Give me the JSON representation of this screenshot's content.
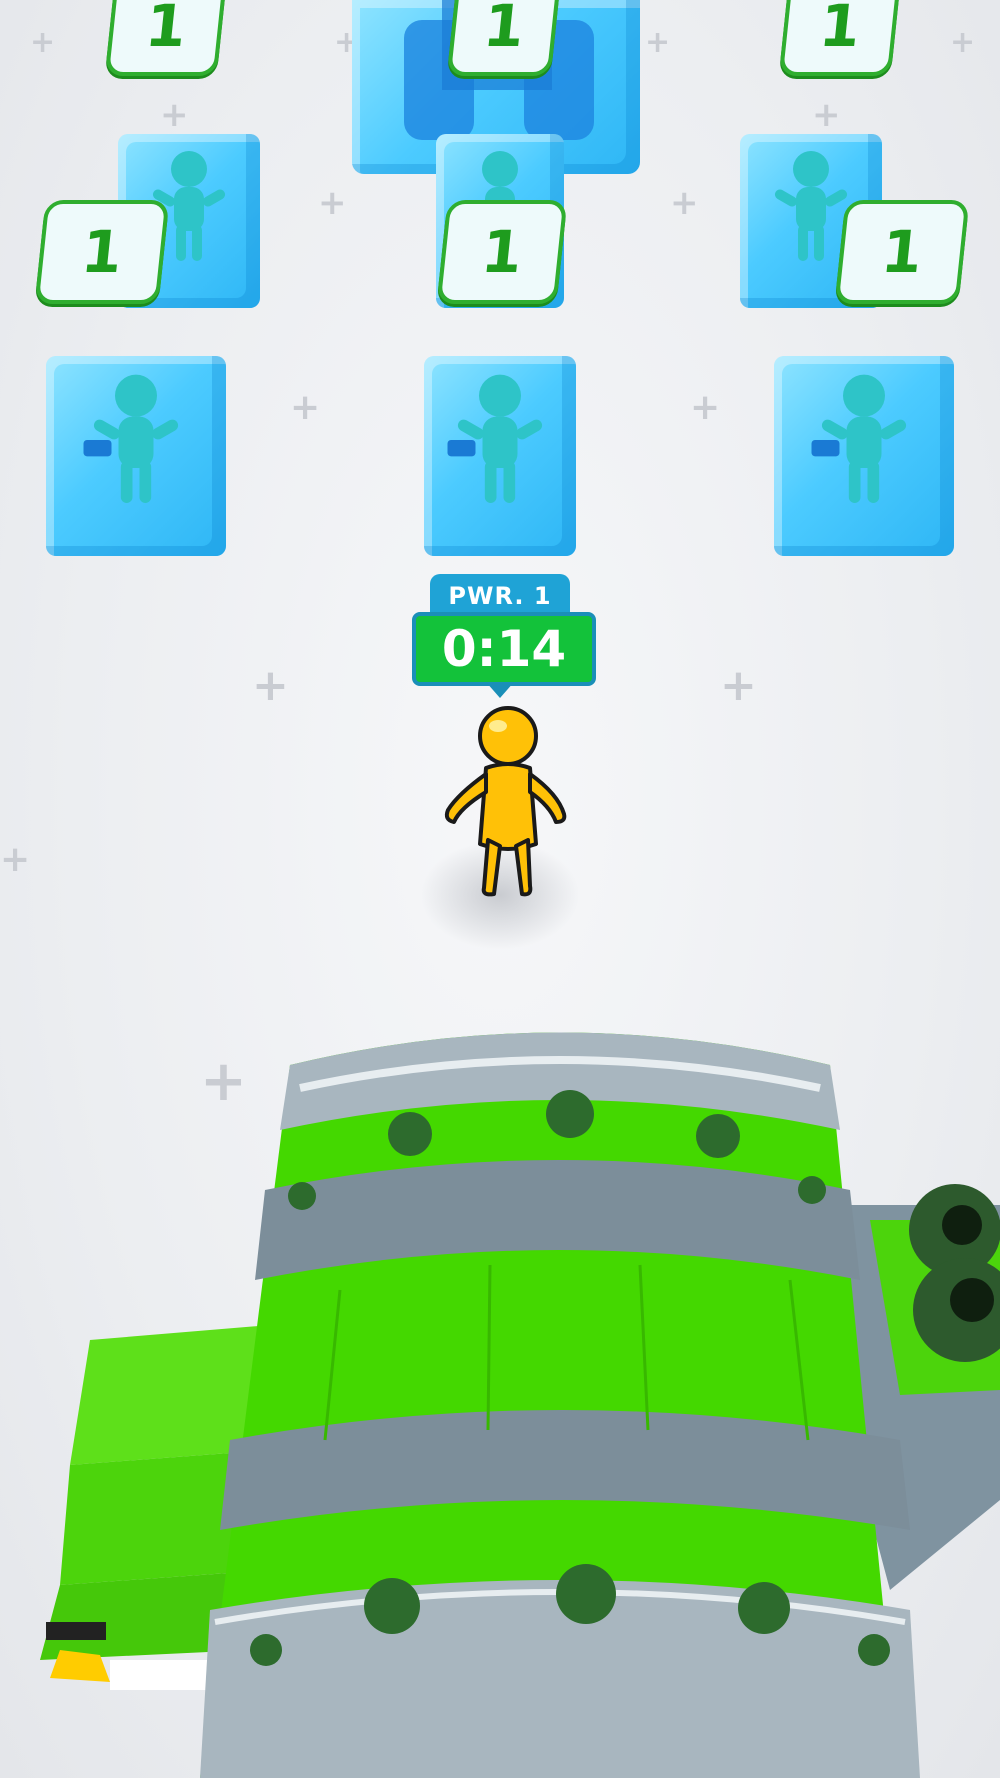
{
  "hud": {
    "power_label": "PWR. 1",
    "timer": "0:14"
  },
  "ice_badges": [
    "1",
    "1",
    "1",
    "1",
    "1",
    "1"
  ],
  "colors": {
    "ice": "#4ccbff",
    "badge_border": "#2fae2f",
    "player": "#ffc107",
    "cannon": "#44d800",
    "timer_bg": "#13c23a",
    "power_bg": "#1fa3d6"
  },
  "icons": [
    "player-character-icon",
    "frozen-ally-icon",
    "ice-block-icon",
    "cannon-icon"
  ]
}
